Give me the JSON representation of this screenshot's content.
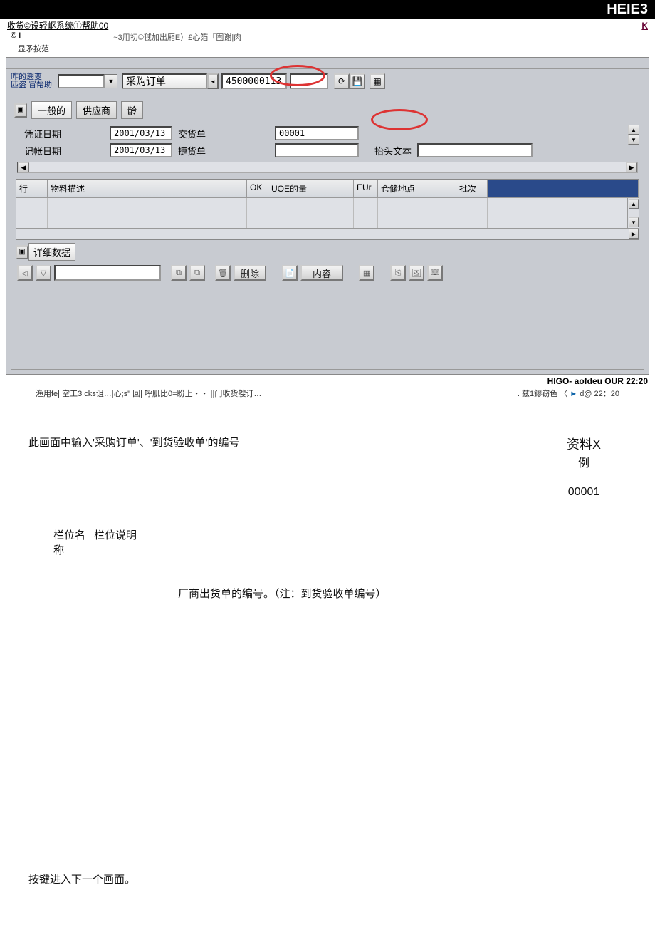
{
  "topbar": {
    "right": "HEIE3"
  },
  "menubar": {
    "left": "收货©设轻岖系统①帮助00",
    "right": "K"
  },
  "sub1": {
    "a": "© I",
    "b": "~3用初©毬加出厢E）£心箔「囿谢|肉"
  },
  "sub2": {
    "a": "显矛按范"
  },
  "dropdown": {
    "main": "采购订单",
    "po_value": "4500000113"
  },
  "tabs": {
    "t1": "一般的",
    "t2": "供应商",
    "t3": "龄"
  },
  "form": {
    "r1_label": "凭证日期",
    "r1_date": "2001/03/13",
    "r1_label2": "交货单",
    "r1_val2": "00001",
    "r2_label": "记帐日期",
    "r2_date": "2001/03/13",
    "r2_label2": "捷货单",
    "r2_label3": "抬头文本"
  },
  "grid": {
    "h1": "行",
    "h2": "物料描述",
    "h3": "OK",
    "h4": "UOE的量",
    "h5": "EUr",
    "h6": "仓储地点",
    "h7": "批次"
  },
  "detail": {
    "tab": "详细数据"
  },
  "actions": {
    "del": "删除",
    "content": "内容"
  },
  "footer": {
    "right": "HIGO- aofdeu OUR 22:20"
  },
  "taskbar": {
    "left": "渔用fe|  空工3 cks诅…|心;s\" 回| 呼肌比0=盼上・・ ||门收货艘订…",
    "right_a": ". 兹1鏐窃色 〈 ",
    "right_b": "►",
    "right_c": " d@ 22：20"
  },
  "doc": {
    "line1": "此画面中输入'采购订单'、'到货验收单'的编号",
    "rc1": "资料X",
    "rc2": "例",
    "rc3": "00001",
    "colH1a": "栏位名",
    "colH1b": "称",
    "colH2": "栏位说明",
    "desc": "厂商出货单的编号。（注：到货验收单编号）",
    "last": "按键进入下一个画面。"
  }
}
